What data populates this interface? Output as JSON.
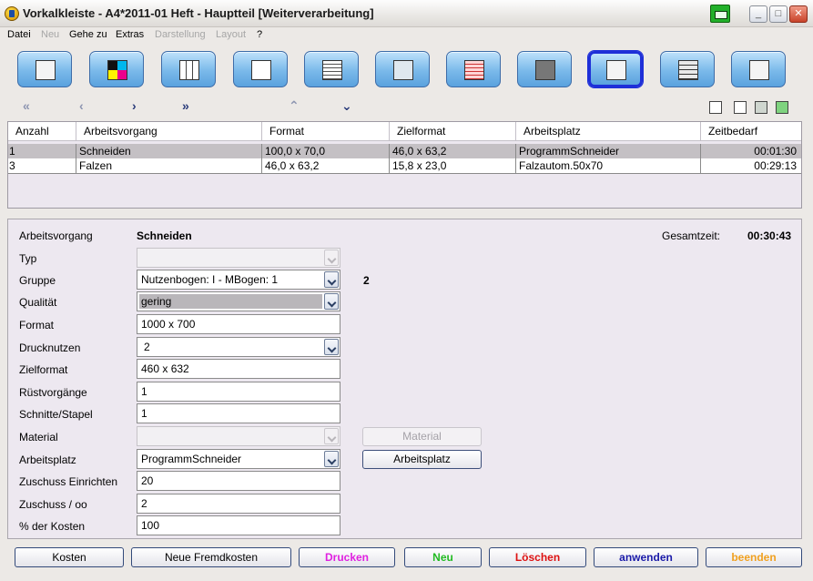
{
  "window": {
    "title": "Vorkalkleiste - A4*2011-01 Heft - Hauptteil [Weiterverarbeitung]",
    "controls": {
      "minimize": "_",
      "maximize": "□",
      "close": "✕"
    }
  },
  "menu": [
    {
      "label": "Datei",
      "enabled": true
    },
    {
      "label": "Neu",
      "enabled": false
    },
    {
      "label": "Gehe zu",
      "enabled": true
    },
    {
      "label": "Extras",
      "enabled": true
    },
    {
      "label": "Darstellung",
      "enabled": false
    },
    {
      "label": "Layout",
      "enabled": false
    },
    {
      "label": "?",
      "enabled": true
    }
  ],
  "toolbar": {
    "icons": [
      "operator-desk-icon",
      "cmyk-icon",
      "grid-layout-icon",
      "page-layout-icon",
      "paper-stack-icon",
      "computer-icon",
      "prepress-screen-icon",
      "factory-icon",
      "workstation-icon",
      "book-stack-icon",
      "finishing-worker-icon"
    ],
    "active_index": 8
  },
  "nav": {
    "first": "«",
    "prev": "‹",
    "next": "›",
    "last": "»",
    "up": "⌃",
    "down": "⌄"
  },
  "table": {
    "headers": [
      "Anzahl",
      "Arbeitsvorgang",
      "Format",
      "Zielformat",
      "Arbeitsplatz",
      "Zeitbedarf"
    ],
    "rows": [
      {
        "anzahl": "1",
        "arbeitsvorgang": "Schneiden",
        "format": "100,0 x 70,0",
        "zielformat": "46,0 x 63,2",
        "arbeitsplatz": "ProgrammSchneider",
        "zeitbedarf": "00:01:30",
        "selected": true
      },
      {
        "anzahl": "3",
        "arbeitsvorgang": "Falzen",
        "format": "46,0 x 63,2",
        "zielformat": "15,8 x 23,0",
        "arbeitsplatz": "Falzautom.50x70",
        "zeitbedarf": "00:29:13",
        "selected": false
      }
    ]
  },
  "form": {
    "arbeitsvorgang_label": "Arbeitsvorgang",
    "arbeitsvorgang_value": "Schneiden",
    "gesamtzeit_label": "Gesamtzeit:",
    "gesamtzeit_value": "00:30:43",
    "typ_label": "Typ",
    "typ_value": "",
    "gruppe_label": "Gruppe",
    "gruppe_value": "Nutzenbogen: I -  MBogen: 1",
    "gruppe_count": "2",
    "qualitaet_label": "Qualität",
    "qualitaet_value": "gering",
    "format_label": "Format",
    "format_value": "1000 x 700",
    "drucknutzen_label": "Drucknutzen",
    "drucknutzen_value": "2",
    "zielformat_label": "Zielformat",
    "zielformat_value": "460 x 632",
    "ruestvorgaenge_label": "Rüstvorgänge",
    "ruestvorgaenge_value": "1",
    "schnitte_label": "Schnitte/Stapel",
    "schnitte_value": "1",
    "material_label": "Material",
    "material_value": "",
    "material_button": "Material",
    "arbeitsplatz_label": "Arbeitsplatz",
    "arbeitsplatz_value": "ProgrammSchneider",
    "arbeitsplatz_button": "Arbeitsplatz",
    "zuschuss_einrichten_label": "Zuschuss Einrichten",
    "zuschuss_einrichten_value": "20",
    "zuschuss_oo_label": "Zuschuss / oo",
    "zuschuss_oo_value": "2",
    "kosten_prozent_label": "% der Kosten",
    "kosten_prozent_value": "100"
  },
  "bottom_buttons": {
    "kosten": "Kosten",
    "neue_fremdkosten": "Neue Fremdkosten",
    "drucken": "Drucken",
    "neu": "Neu",
    "loeschen": "Löschen",
    "anwenden": "anwenden",
    "beenden": "beenden"
  },
  "colors": {
    "drucken": "#e020e0",
    "neu": "#22bb22",
    "loeschen": "#dd1111",
    "anwenden": "#1a1aa8",
    "beenden": "#f0a020",
    "accent_active_tool": "#1e2fd8"
  }
}
